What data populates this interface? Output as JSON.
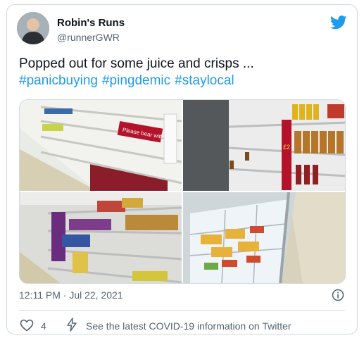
{
  "user": {
    "display_name": "Robin's Runs",
    "handle": "@runnerGWR"
  },
  "tweet": {
    "text": "Popped out for some juice and crisps ...",
    "hashtags": [
      "#panicbuying",
      "#pingdemic",
      "#staylocal"
    ]
  },
  "photos": {
    "sign_top_left": "Please bear with us",
    "price_tag": "£2"
  },
  "meta": {
    "timestamp": "12:11 PM · Jul 22, 2021"
  },
  "actions": {
    "like_count": "4",
    "covid_link": "See the latest COVID-19 information on Twitter"
  },
  "colors": {
    "link": "#1d9bf0",
    "muted": "#536471",
    "border": "#cfd9de",
    "sign_red": "#b3122a"
  },
  "icons": [
    "twitter-bird-icon",
    "info-icon",
    "heart-icon",
    "lightning-icon"
  ]
}
